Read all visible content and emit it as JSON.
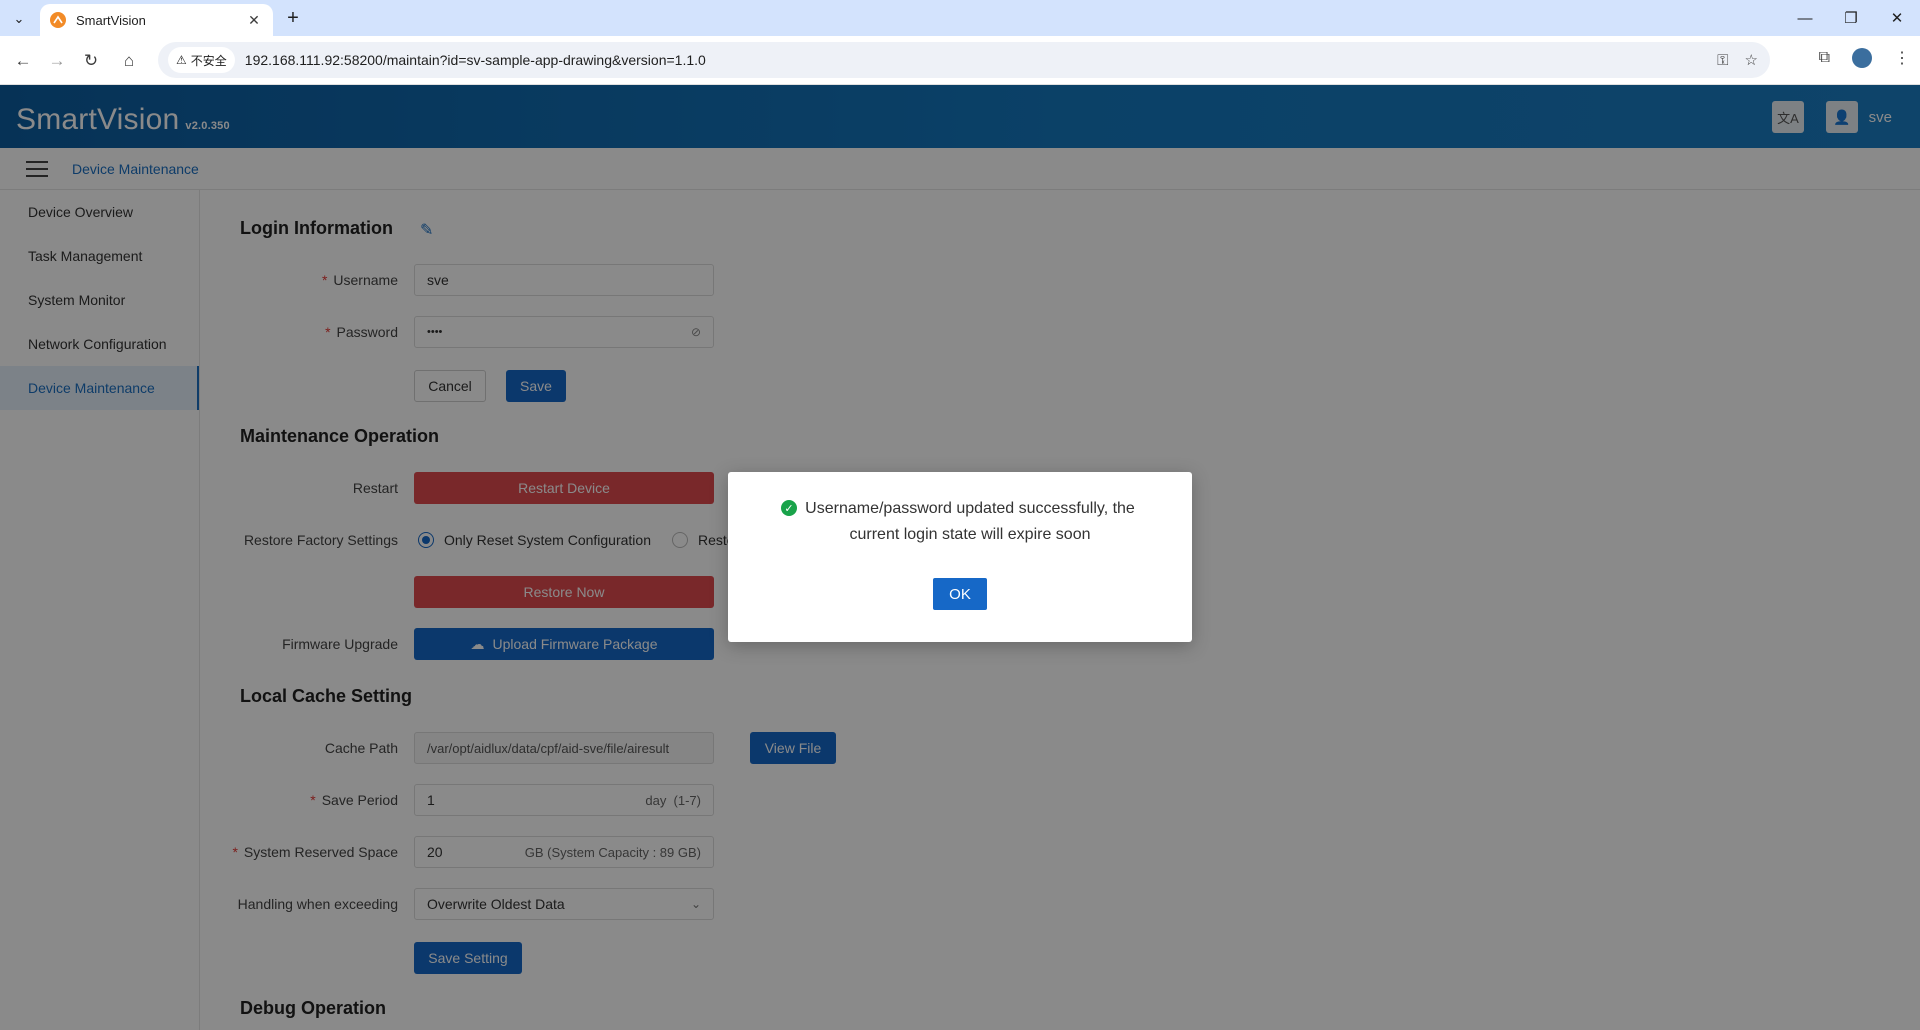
{
  "browser": {
    "tab_title": "SmartVision",
    "security_label": "不安全",
    "url": "192.168.111.92:58200/maintain?id=sv-sample-app-drawing&version=1.1.0"
  },
  "app": {
    "brand": "SmartVision",
    "version": "v2.0.350",
    "user": "sve",
    "breadcrumb": "Device Maintenance"
  },
  "sidebar": {
    "items": [
      {
        "label": "Device Overview"
      },
      {
        "label": "Task Management"
      },
      {
        "label": "System Monitor"
      },
      {
        "label": "Network Configuration"
      },
      {
        "label": "Device Maintenance",
        "active": true
      }
    ]
  },
  "login": {
    "title": "Login Information",
    "username_label": "Username",
    "username_value": "sve",
    "password_label": "Password",
    "password_value": "••••",
    "cancel_label": "Cancel",
    "save_label": "Save"
  },
  "maintenance": {
    "title": "Maintenance Operation",
    "restart_label": "Restart",
    "restart_button": "Restart Device",
    "factory_label": "Restore Factory Settings",
    "option_1": "Only Reset System Configuration",
    "option_2": "Reste",
    "restore_button": "Restore Now",
    "firmware_label": "Firmware Upgrade",
    "upload_button": "Upload Firmware Package"
  },
  "cache": {
    "title": "Local Cache Setting",
    "path_label": "Cache Path",
    "path_value": "/var/opt/aidlux/data/cpf/aid-sve/file/airesult",
    "view_button": "View File",
    "period_label": "Save Period",
    "period_value": "1",
    "period_unit": "day  (1-7)",
    "space_label": "System Reserved Space",
    "space_value": "20",
    "space_unit": "GB (System Capacity : 89 GB)",
    "handling_label": "Handling when exceeding",
    "handling_value": "Overwrite Oldest Data",
    "save_setting_button": "Save Setting"
  },
  "debug": {
    "title": "Debug Operation"
  },
  "dialog": {
    "message": "Username/password updated successfully, the current login state will expire soon",
    "ok_label": "OK"
  },
  "colors": {
    "primary": "#1668c7",
    "danger": "#e04a4f",
    "success": "#19a34a",
    "header": "#1a6fb5"
  }
}
